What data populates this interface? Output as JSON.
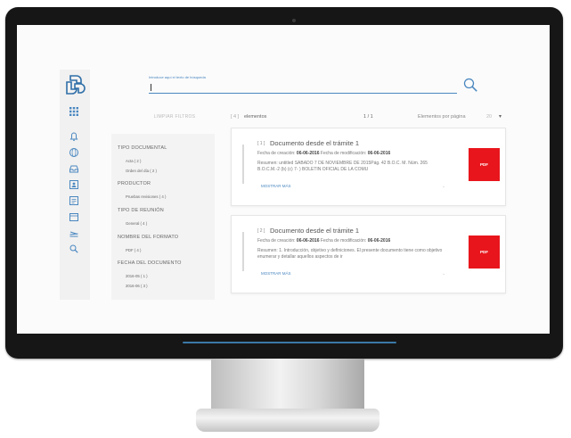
{
  "search": {
    "label": "Introduce aquí el texto de búsqueda"
  },
  "filters": {
    "clear_label": "LIMPIAR FILTROS",
    "groups": [
      {
        "title": "TIPO DOCUMENTAL",
        "items": [
          "Acta ( 2 )",
          "Orden del día ( 2 )"
        ]
      },
      {
        "title": "PRODUCTOR",
        "items": [
          "Pruebas revisiones ( 4 )"
        ]
      },
      {
        "title": "TIPO DE REUNIÓN",
        "items": [
          "General ( 4 )"
        ]
      },
      {
        "title": "NOMBRE DEL FORMATO",
        "items": [
          "PDF ( 4 )"
        ]
      },
      {
        "title": "FECHA DEL DOCUMENTO",
        "items": [
          "2016-05 ( 1 )",
          "2016-06 ( 3 )"
        ]
      }
    ]
  },
  "results": {
    "count": "[ 4 ]",
    "count_label": "elementos",
    "page": "1 / 1",
    "per_page_label": "Elementos por página",
    "per_page_value": "20"
  },
  "cards": [
    {
      "num": "[ 1 ]",
      "title": "Documento desde el trámite 1",
      "created_label": "Fecha de creación:",
      "created": "06-06-2016",
      "modified_label": "Fecha de modificación:",
      "modified": "06-06-2016",
      "summary": "Resumen: untitled SABADO 7 DE NOVIEMBRE DE 2015Pág. 42 B.O.C. M. Núm. 265 B.O.C.M.-2 (b) (c) 7- ) BOLETIN OFICIAL DE LA COMU",
      "more": "MOSTRAR MÁS",
      "format": "PDF"
    },
    {
      "num": "[ 2 ]",
      "title": "Documento desde el trámite 1",
      "created_label": "Fecha de creación:",
      "created": "06-06-2016",
      "modified_label": "Fecha de modificación:",
      "modified": "06-06-2016",
      "summary": "Resumen: 1. Introducción, objetivo y definiciones. El presente documento tiene como objetivo enumerar y detallar aquellos aspectos de ir",
      "more": "MOSTRAR MÁS",
      "format": "PDF"
    }
  ],
  "colors": {
    "accent": "#4a87c0",
    "pdf": "#e8161c",
    "bezel": "#161616"
  }
}
